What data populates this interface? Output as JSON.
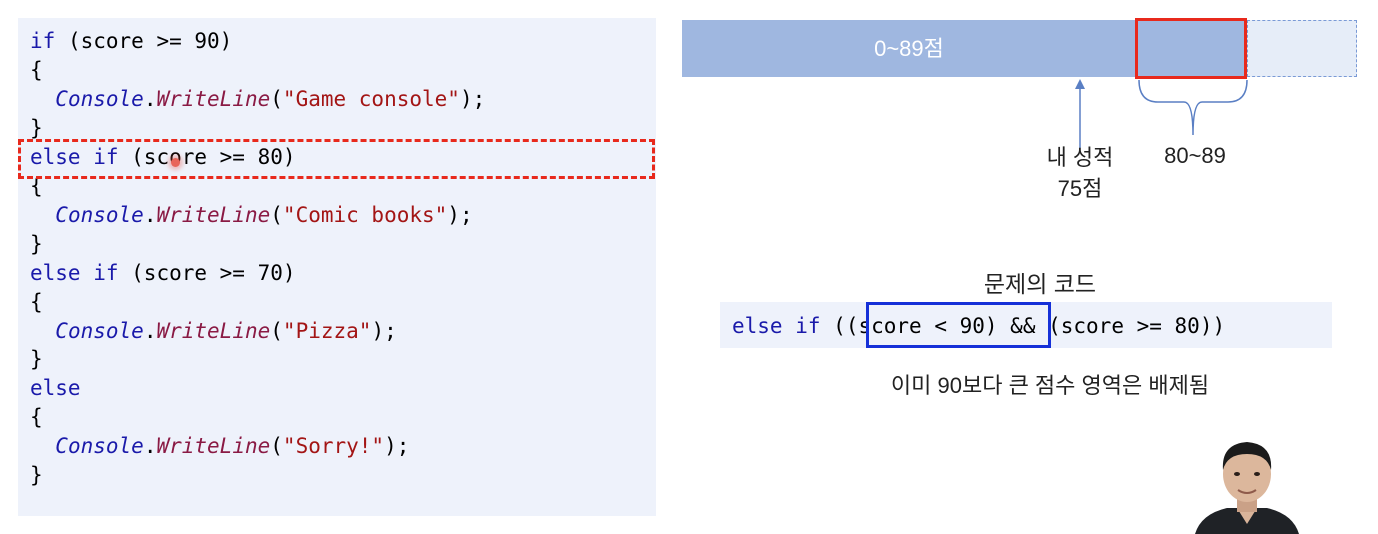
{
  "code": {
    "lines": [
      [
        {
          "t": "if",
          "c": "kw"
        },
        {
          "t": " (score >= 90)",
          "c": ""
        }
      ],
      [
        {
          "t": "{",
          "c": ""
        }
      ],
      [
        {
          "t": "  ",
          "c": ""
        },
        {
          "t": "Console",
          "c": "ty"
        },
        {
          "t": ".",
          "c": ""
        },
        {
          "t": "WriteLine",
          "c": "mt"
        },
        {
          "t": "(",
          "c": ""
        },
        {
          "t": "\"Game console\"",
          "c": "st"
        },
        {
          "t": ");",
          "c": ""
        }
      ],
      [
        {
          "t": "}",
          "c": ""
        }
      ],
      [
        {
          "t": "else if",
          "c": "kw"
        },
        {
          "t": " (score >= 80)",
          "c": ""
        }
      ],
      [
        {
          "t": "{",
          "c": ""
        }
      ],
      [
        {
          "t": "  ",
          "c": ""
        },
        {
          "t": "Console",
          "c": "ty"
        },
        {
          "t": ".",
          "c": ""
        },
        {
          "t": "WriteLine",
          "c": "mt"
        },
        {
          "t": "(",
          "c": ""
        },
        {
          "t": "\"Comic books\"",
          "c": "st"
        },
        {
          "t": ");",
          "c": ""
        }
      ],
      [
        {
          "t": "}",
          "c": ""
        }
      ],
      [
        {
          "t": "else if",
          "c": "kw"
        },
        {
          "t": " (score >= 70)",
          "c": ""
        }
      ],
      [
        {
          "t": "{",
          "c": ""
        }
      ],
      [
        {
          "t": "  ",
          "c": ""
        },
        {
          "t": "Console",
          "c": "ty"
        },
        {
          "t": ".",
          "c": ""
        },
        {
          "t": "WriteLine",
          "c": "mt"
        },
        {
          "t": "(",
          "c": ""
        },
        {
          "t": "\"Pizza\"",
          "c": "st"
        },
        {
          "t": ");",
          "c": ""
        }
      ],
      [
        {
          "t": "}",
          "c": ""
        }
      ],
      [
        {
          "t": "else",
          "c": "kw"
        }
      ],
      [
        {
          "t": "{",
          "c": ""
        }
      ],
      [
        {
          "t": "  ",
          "c": ""
        },
        {
          "t": "Console",
          "c": "ty"
        },
        {
          "t": ".",
          "c": ""
        },
        {
          "t": "WriteLine",
          "c": "mt"
        },
        {
          "t": "(",
          "c": ""
        },
        {
          "t": "\"Sorry!\"",
          "c": "st"
        },
        {
          "t": ");",
          "c": ""
        }
      ],
      [
        {
          "t": "}",
          "c": ""
        }
      ]
    ]
  },
  "diagram": {
    "range_label": "0~89점",
    "my_score_line1": "내 성적",
    "my_score_line2": "75점",
    "range_80_89": "80~89",
    "problem_title": "문제의 코드",
    "problem_code": [
      {
        "t": "else if",
        "c": "kw"
      },
      {
        "t": " (",
        "c": ""
      },
      {
        "t": "(score < 90)",
        "c": ""
      },
      {
        "t": " && (score >= 80))",
        "c": ""
      }
    ],
    "note": "이미 90보다 큰 점수 영역은 배제됨"
  },
  "colors": {
    "keyword": "#1a1aaa",
    "method": "#8a1a44",
    "string": "#a31515",
    "highlight_red": "#e8291c",
    "highlight_blue": "#1530d8",
    "bar": "#9fb7e0",
    "panel": "#eef2fb"
  }
}
